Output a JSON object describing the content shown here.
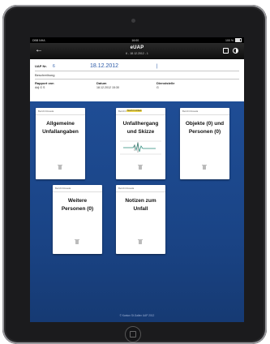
{
  "statusbar": {
    "carrier": "DBB NHA",
    "wifi": "wifi-icon",
    "time": "16:00",
    "battery": "100 %"
  },
  "navbar": {
    "title": "eUAP",
    "subtitle": "6 - 18.12.2012 - 1",
    "back_icon": "back-arrow-icon",
    "edit_icon": "edit-icon",
    "contrast_icon": "contrast-icon"
  },
  "form": {
    "uap_label": "UAP Nr.",
    "uap_number": "6",
    "uap_date": "18.12.2012",
    "divider": "|",
    "description_label": "Beschreibung",
    "report_label": "Rapport von",
    "report_value": "Adj G S",
    "date_label": "Datum",
    "date_value": "18.12.2012 15:30",
    "office_label": "Dienststelle",
    "office_value": "G"
  },
  "cards": [
    {
      "header": "Bericht Rosada",
      "title_line1": "Allgemeine",
      "title_line2": "Unfallangaben"
    },
    {
      "header": "Bericht Rosada",
      "badge": "Noch in Arbeit",
      "title_line1": "Unfallhergang",
      "title_line2": "und Skizze"
    },
    {
      "header": "Bericht Rosada",
      "title_line1": "Objekte (0) und",
      "title_line2": "Personen (0)"
    },
    {
      "header": "Bericht Rosada",
      "title_line1": "Weitere",
      "title_line2": "Personen (0)"
    },
    {
      "header": "Bericht Rosada",
      "title_line1": "Notizen zum",
      "title_line2": "Unfall"
    }
  ],
  "footer": {
    "copyright": "© Kanton St.Gallen UAP 2012"
  },
  "colors": {
    "background_blue": "#1b4589",
    "accent_text": "#2b5aa8",
    "badge_yellow": "#f0d84a"
  }
}
